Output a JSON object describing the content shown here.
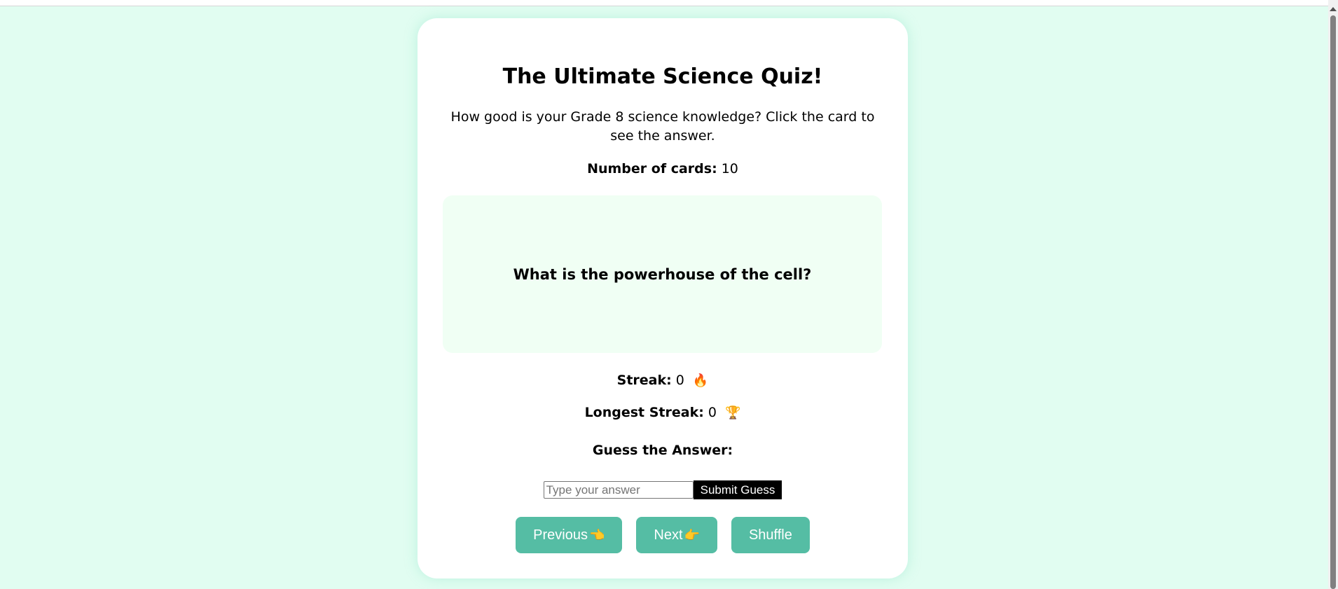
{
  "page": {
    "title": "The Ultimate Science Quiz!",
    "description": "How good is your Grade 8 science knowledge? Click the card to see the answer.",
    "card_count_label": "Number of cards:",
    "card_count_value": "10"
  },
  "flashcard": {
    "question": "What is the powerhouse of the cell?"
  },
  "stats": {
    "streak_label": "Streak:",
    "streak_value": "0",
    "streak_icon": "🔥",
    "longest_label": "Longest Streak:",
    "longest_value": "0",
    "longest_icon": "🏆"
  },
  "guess": {
    "label": "Guess the Answer:",
    "placeholder": "Type your answer",
    "value": "",
    "submit_label": "Submit Guess"
  },
  "navigation": {
    "previous_label": "Previous",
    "previous_icon": "👈",
    "next_label": "Next",
    "next_icon": "👉",
    "shuffle_label": "Shuffle"
  },
  "colors": {
    "background": "#e1fdf1",
    "card_background": "#f0fff4",
    "button": "#55bda4",
    "submit_button": "#000000"
  }
}
